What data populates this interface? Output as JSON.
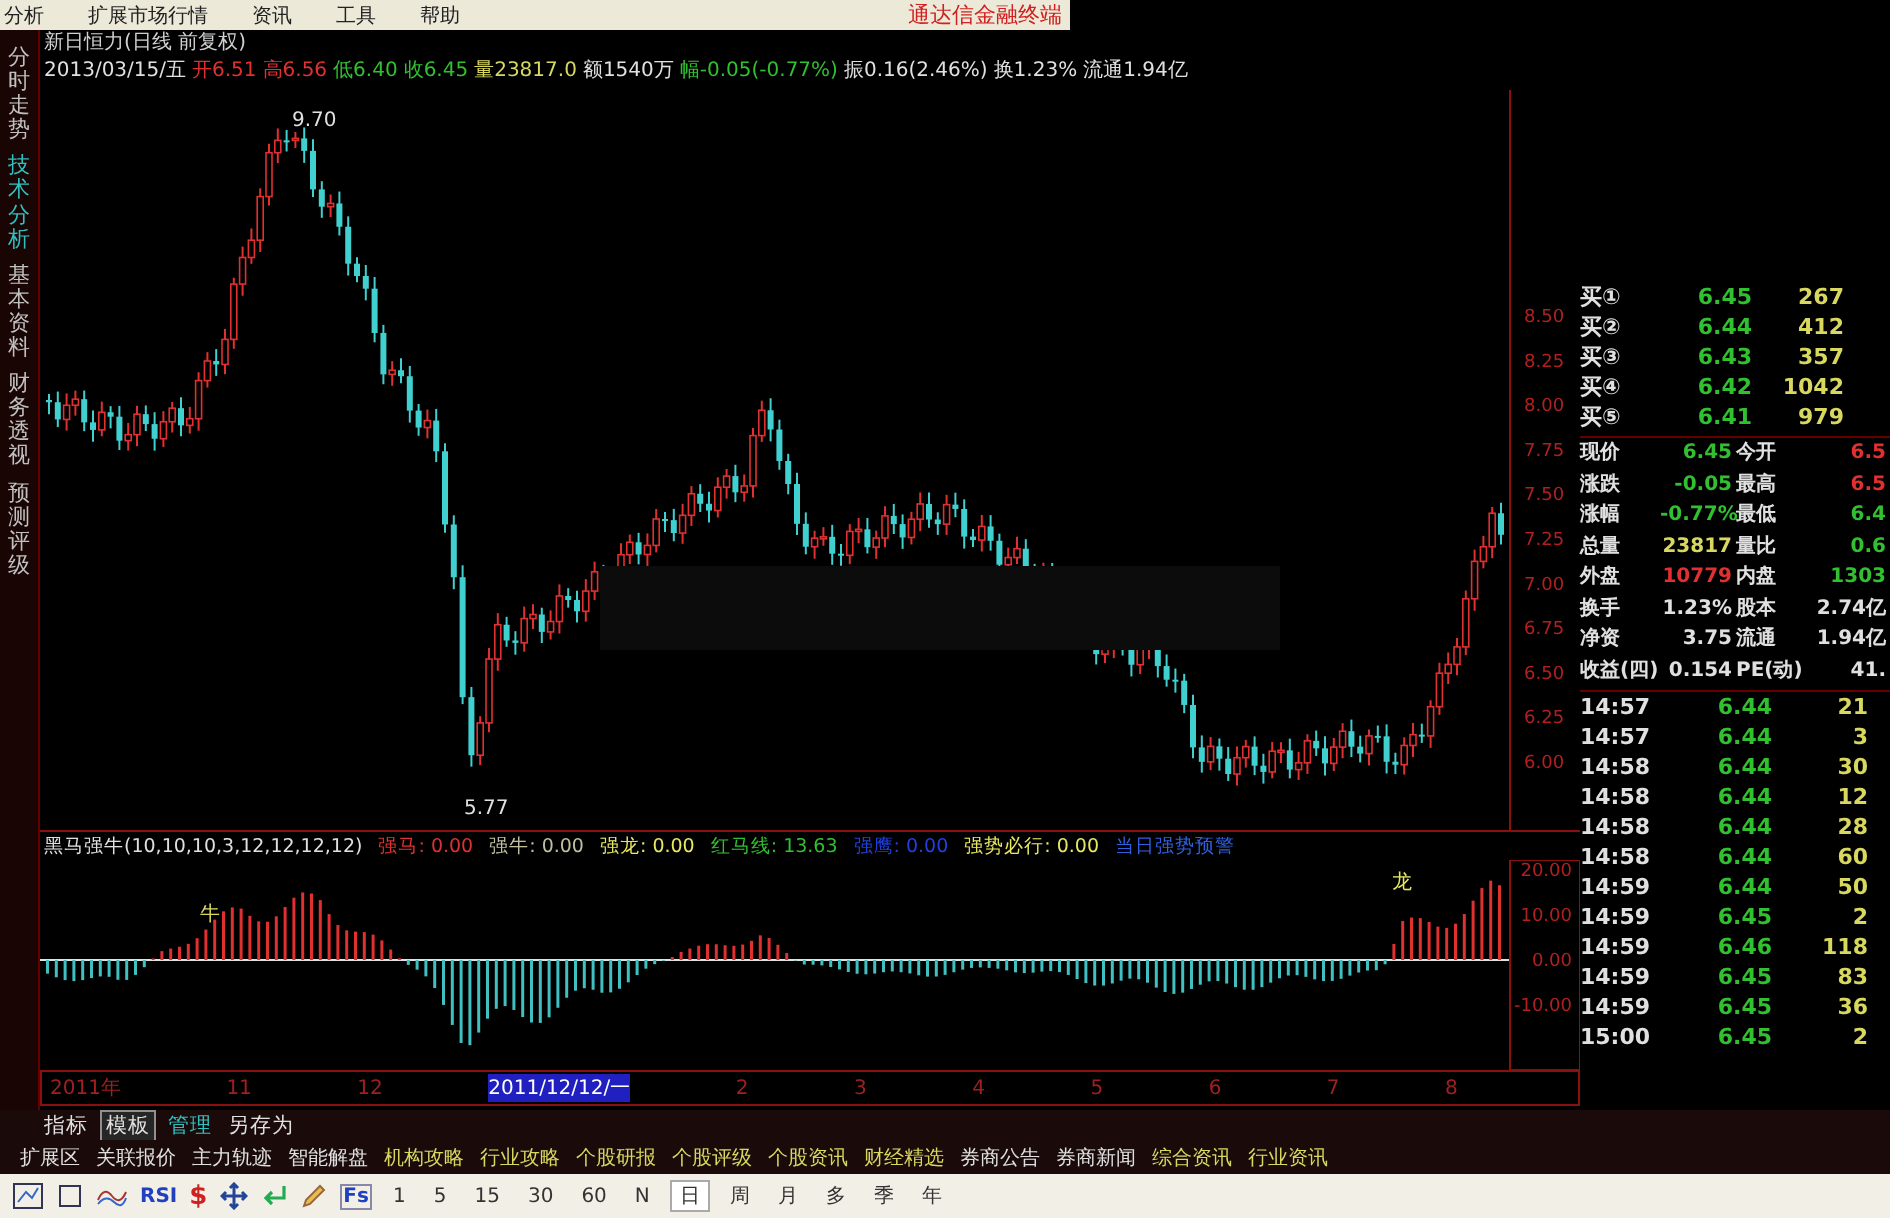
{
  "menu": {
    "items": [
      "分析",
      "扩展市场行情",
      "资讯",
      "工具",
      "帮助"
    ],
    "brand": "通达信金融终端"
  },
  "side_tabs": [
    {
      "label": "分时走势",
      "selected": false
    },
    {
      "label": "技术分析",
      "selected": true
    },
    {
      "label": "基本资料",
      "selected": false
    },
    {
      "label": "财务透视",
      "selected": false
    },
    {
      "label": "预测评级",
      "selected": false
    }
  ],
  "chart": {
    "title": "新日恒力(日线 前复权)",
    "quote_line": [
      {
        "text": "2013/03/15/五",
        "color": "#e0e0e0"
      },
      {
        "text": "开6.51",
        "color": "#e03030"
      },
      {
        "text": "高6.56",
        "color": "#e03030"
      },
      {
        "text": "低6.40",
        "color": "#30c030"
      },
      {
        "text": "收6.45",
        "color": "#30c030"
      },
      {
        "text": "量23817.0",
        "color": "#d8d860"
      },
      {
        "text": "额1540万",
        "color": "#e0e0e0"
      },
      {
        "text": "幅-0.05(-0.77%)",
        "color": "#30c030"
      },
      {
        "text": "振0.16(2.46%)",
        "color": "#e0e0e0"
      },
      {
        "text": "换1.23%",
        "color": "#e0e0e0"
      },
      {
        "text": "流通1.94亿",
        "color": "#e0e0e0"
      }
    ],
    "high_label": "9.70",
    "low_label": "5.77",
    "price_axis": [
      "8.50",
      "8.25",
      "8.00",
      "7.75",
      "7.50",
      "7.25",
      "7.00",
      "6.75",
      "6.50",
      "6.25",
      "6.00"
    ]
  },
  "indicator": {
    "title": "黑马强牛(10,10,10,3,12,12,12,12)",
    "values": [
      {
        "label": "强马:",
        "value": "0.00",
        "color": "#e03030"
      },
      {
        "label": "强牛:",
        "value": "0.00",
        "color": "#c0c0a0"
      },
      {
        "label": "强龙:",
        "value": "0.00",
        "color": "#e8e860"
      },
      {
        "label": "红马线:",
        "value": "13.63",
        "color": "#30c030"
      },
      {
        "label": "强鹰:",
        "value": "0.00",
        "color": "#2040e0"
      },
      {
        "label": "强势必行:",
        "value": "0.00",
        "color": "#e8e860"
      },
      {
        "label": "当日强势预警",
        "color": "#3060e0"
      }
    ],
    "markers": [
      "牛",
      "龙"
    ],
    "axis": [
      "20.00",
      "10.00",
      "0.00",
      "-10.00"
    ]
  },
  "date_axis": [
    {
      "label": "2011年",
      "selected": false
    },
    {
      "label": "11",
      "selected": false
    },
    {
      "label": "12",
      "selected": false
    },
    {
      "label": "2011/12/12/一",
      "selected": true
    },
    {
      "label": "2",
      "selected": false
    },
    {
      "label": "3",
      "selected": false
    },
    {
      "label": "4",
      "selected": false
    },
    {
      "label": "5",
      "selected": false
    },
    {
      "label": "6",
      "selected": false
    },
    {
      "label": "7",
      "selected": false
    },
    {
      "label": "8",
      "selected": false
    }
  ],
  "bottom_tabs": [
    {
      "label": "指标",
      "selected": false,
      "color": "#e0e0e0"
    },
    {
      "label": "模板",
      "selected": true,
      "color": "#e0e0e0"
    },
    {
      "label": "管理",
      "selected": false,
      "color": "#30c0c0"
    },
    {
      "label": "另存为",
      "selected": false,
      "color": "#e0e0e0"
    }
  ],
  "function_bar": [
    {
      "label": "扩展区",
      "color": "#e0e0e0"
    },
    {
      "label": "关联报价",
      "color": "#e0e0e0"
    },
    {
      "label": "主力轨迹",
      "color": "#e0e0e0"
    },
    {
      "label": "智能解盘",
      "color": "#e0e0e0"
    },
    {
      "label": "机构攻略",
      "color": "#d8d860"
    },
    {
      "label": "行业攻略",
      "color": "#d8d860"
    },
    {
      "label": "个股研报",
      "color": "#d8d860"
    },
    {
      "label": "个股评级",
      "color": "#d8d860"
    },
    {
      "label": "个股资讯",
      "color": "#d8d860"
    },
    {
      "label": "财经精选",
      "color": "#d8d860"
    },
    {
      "label": "券商公告",
      "color": "#e0e0e0"
    },
    {
      "label": "券商新闻",
      "color": "#e0e0e0"
    },
    {
      "label": "综合资讯",
      "color": "#d8d860"
    },
    {
      "label": "行业资讯",
      "color": "#d8d860"
    }
  ],
  "toolbar": {
    "tool_labels": [
      "RSI",
      "$",
      "Fs"
    ],
    "periods": [
      {
        "label": "1",
        "selected": false
      },
      {
        "label": "5",
        "selected": false
      },
      {
        "label": "15",
        "selected": false
      },
      {
        "label": "30",
        "selected": false
      },
      {
        "label": "60",
        "selected": false
      },
      {
        "label": "N",
        "selected": false
      },
      {
        "label": "日",
        "selected": true
      },
      {
        "label": "周",
        "selected": false
      },
      {
        "label": "月",
        "selected": false
      },
      {
        "label": "多",
        "selected": false
      },
      {
        "label": "季",
        "selected": false
      },
      {
        "label": "年",
        "selected": false
      }
    ]
  },
  "quote_panel": {
    "order_book": [
      {
        "label": "买①",
        "price": "6.45",
        "volume": "267"
      },
      {
        "label": "买②",
        "price": "6.44",
        "volume": "412"
      },
      {
        "label": "买③",
        "price": "6.43",
        "volume": "357"
      },
      {
        "label": "买④",
        "price": "6.42",
        "volume": "1042"
      },
      {
        "label": "买⑤",
        "price": "6.41",
        "volume": "979"
      }
    ],
    "stats": [
      {
        "label": "现价",
        "value": "6.45",
        "color": "#30c030"
      },
      {
        "label": "今开",
        "value": "6.5",
        "color": "#e03030"
      },
      {
        "label": "涨跌",
        "value": "-0.05",
        "color": "#30c030"
      },
      {
        "label": "最高",
        "value": "6.5",
        "color": "#e03030"
      },
      {
        "label": "涨幅",
        "value": "-0.77%",
        "color": "#30c030"
      },
      {
        "label": "最低",
        "value": "6.4",
        "color": "#30c030"
      },
      {
        "label": "总量",
        "value": "23817",
        "color": "#d8d860"
      },
      {
        "label": "量比",
        "value": "0.6",
        "color": "#30c030"
      },
      {
        "label": "外盘",
        "value": "10779",
        "color": "#e03030"
      },
      {
        "label": "内盘",
        "value": "1303",
        "color": "#30c030"
      },
      {
        "label": "换手",
        "value": "1.23%",
        "color": "#e0e0e0"
      },
      {
        "label": "股本",
        "value": "2.74亿",
        "color": "#e0e0e0"
      },
      {
        "label": "净资",
        "value": "3.75",
        "color": "#e0e0e0"
      },
      {
        "label": "流通",
        "value": "1.94亿",
        "color": "#e0e0e0"
      },
      {
        "label": "收益(四)",
        "value": "0.154",
        "color": "#e0e0e0"
      },
      {
        "label": "PE(动)",
        "value": "41.",
        "color": "#e0e0e0"
      }
    ],
    "ticks": [
      {
        "time": "14:57",
        "price": "6.44",
        "volume": "21"
      },
      {
        "time": "14:57",
        "price": "6.44",
        "volume": "3"
      },
      {
        "time": "14:58",
        "price": "6.44",
        "volume": "30"
      },
      {
        "time": "14:58",
        "price": "6.44",
        "volume": "12"
      },
      {
        "time": "14:58",
        "price": "6.44",
        "volume": "28"
      },
      {
        "time": "14:58",
        "price": "6.44",
        "volume": "60"
      },
      {
        "time": "14:59",
        "price": "6.44",
        "volume": "50"
      },
      {
        "time": "14:59",
        "price": "6.45",
        "volume": "2"
      },
      {
        "time": "14:59",
        "price": "6.46",
        "volume": "118"
      },
      {
        "time": "14:59",
        "price": "6.45",
        "volume": "83"
      },
      {
        "time": "14:59",
        "price": "6.45",
        "volume": "36"
      },
      {
        "time": "15:00",
        "price": "6.45",
        "volume": "2"
      }
    ]
  }
}
